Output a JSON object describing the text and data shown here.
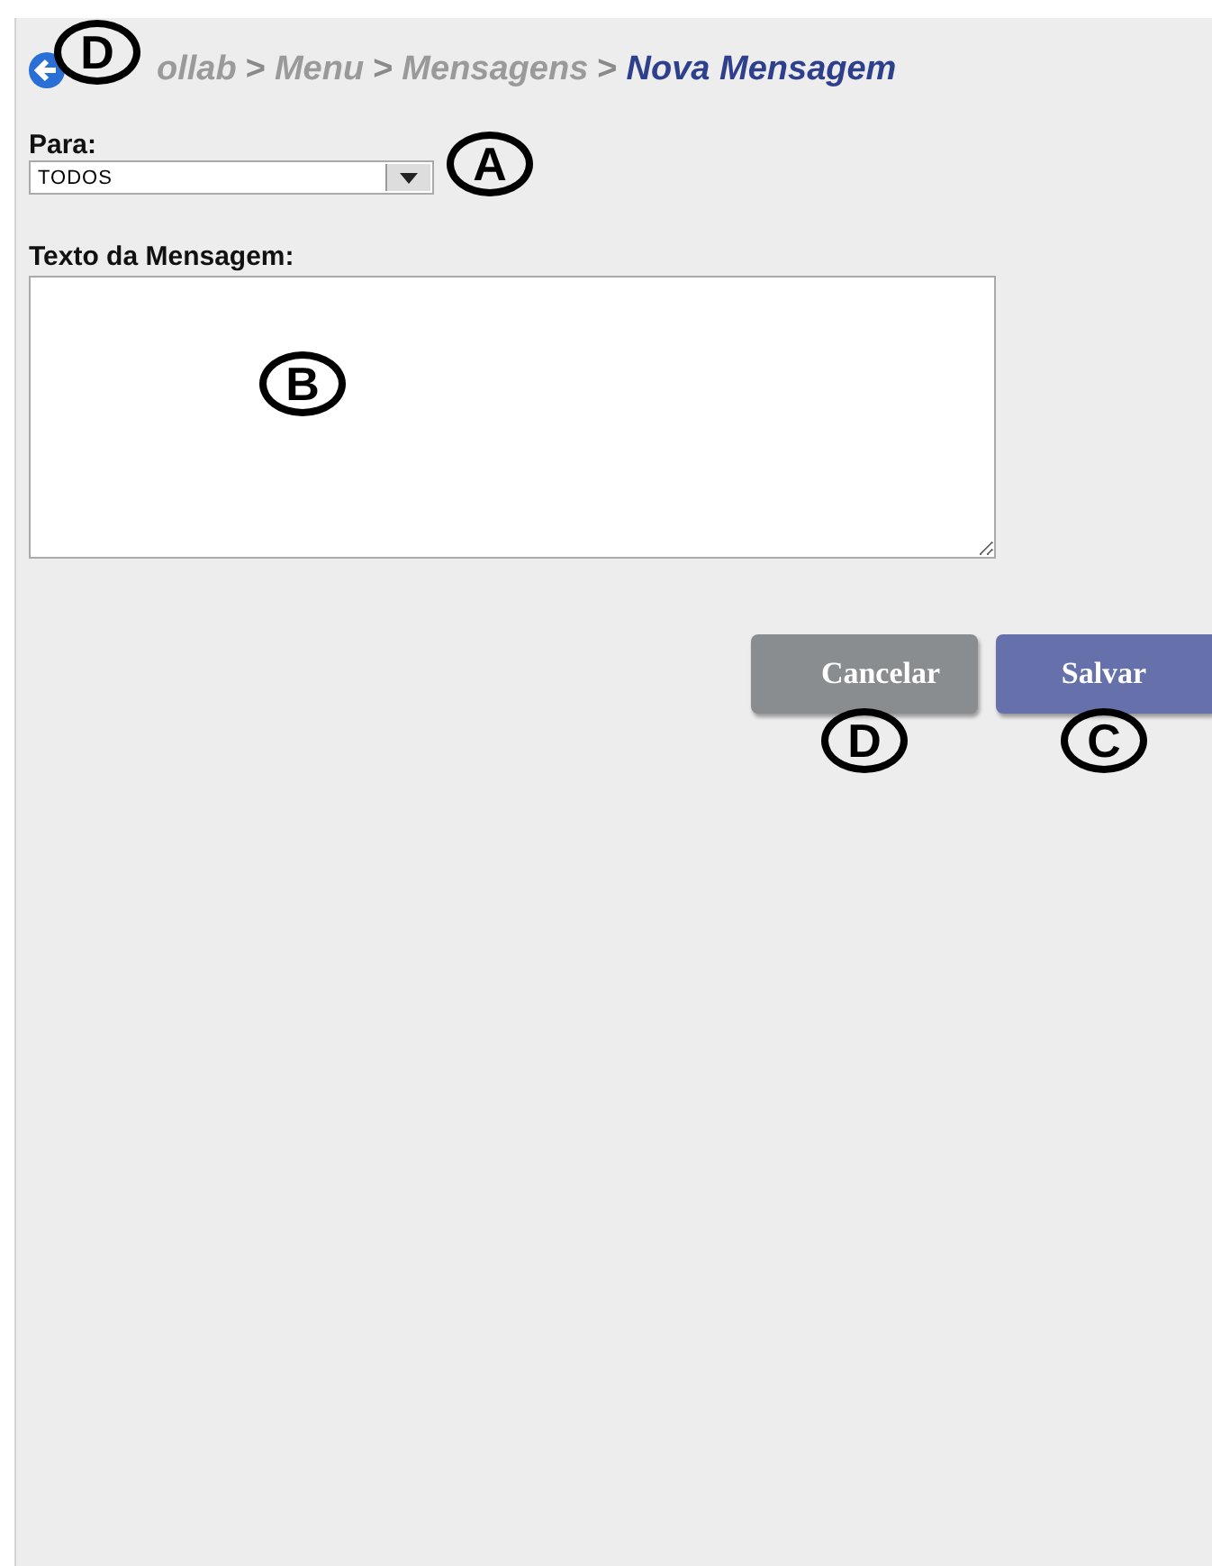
{
  "breadcrumb": {
    "callout": "D",
    "items": [
      {
        "label": "ollab",
        "current": false
      },
      {
        "label": "Menu",
        "current": false
      },
      {
        "label": "Mensagens",
        "current": false
      },
      {
        "label": "Nova Mensagem",
        "current": true
      }
    ],
    "separator": ">"
  },
  "recipient": {
    "label": "Para:",
    "value": "TODOS",
    "callout": "A"
  },
  "message": {
    "label": "Texto da Mensagem:",
    "callout": "B"
  },
  "buttons": [
    {
      "label": "Cancelar",
      "kind": "secondary",
      "callout": "D"
    },
    {
      "label": "Salvar",
      "kind": "primary",
      "callout": "C"
    }
  ]
}
